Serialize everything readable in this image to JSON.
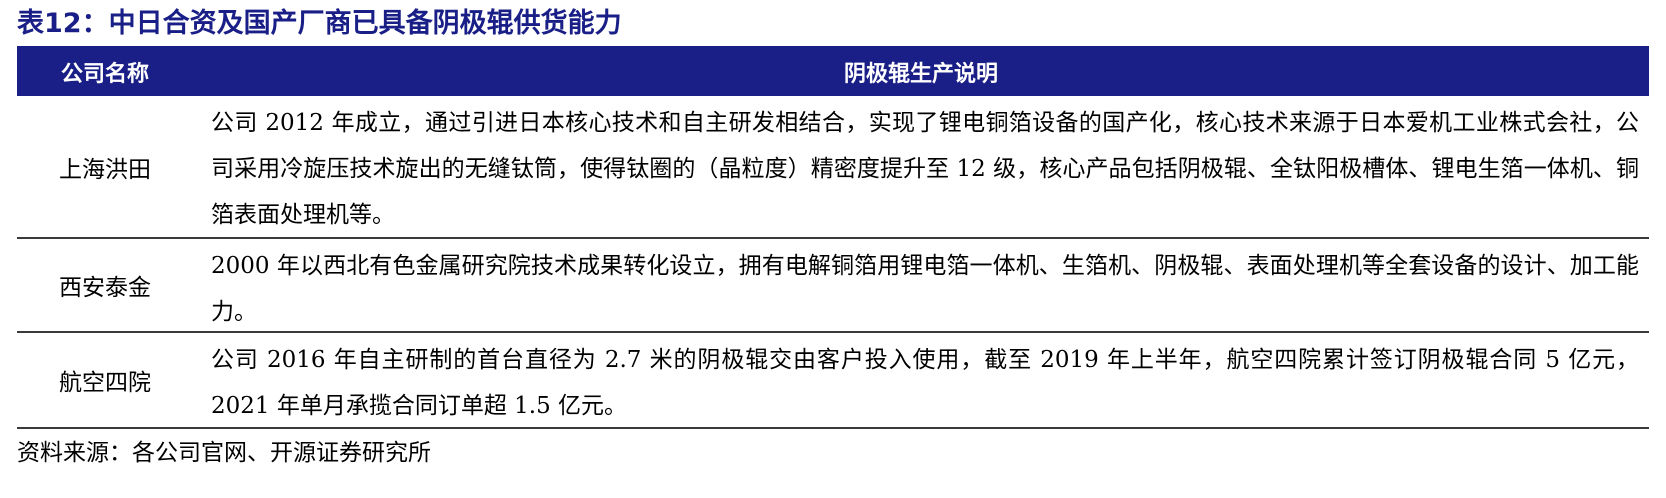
{
  "title": "表12：中日合资及国产厂商已具备阴极辊供货能力",
  "table": {
    "headers": [
      "公司名称",
      "阴极辊生产说明"
    ],
    "rows": [
      {
        "company": "上海洪田",
        "description": "公司 2012 年成立，通过引进日本核心技术和自主研发相结合，实现了锂电铜箔设备的国产化，核心技术来源于日本爱机工业株式会社，公司采用冷旋压技术旋出的无缝钛筒，使得钛圈的（晶粒度）精密度提升至 12 级，核心产品包括阴极辊、全钛阳极槽体、锂电生箔一体机、铜箔表面处理机等。"
      },
      {
        "company": "西安泰金",
        "description": "2000 年以西北有色金属研究院技术成果转化设立，拥有电解铜箔用锂电箔一体机、生箔机、阴极辊、表面处理机等全套设备的设计、加工能力。"
      },
      {
        "company": "航空四院",
        "description": "公司 2016 年自主研制的首台直径为 2.7 米的阴极辊交由客户投入使用，截至 2019 年上半年，航空四院累计签订阴极辊合同 5 亿元，2021 年单月承揽合同订单超 1.5 亿元。"
      }
    ]
  },
  "source": "资料来源：各公司官网、开源证券研究所",
  "colors": {
    "accent": "#1a1f87",
    "header_text": "#ffffff",
    "rule": "#3a3a3a"
  }
}
